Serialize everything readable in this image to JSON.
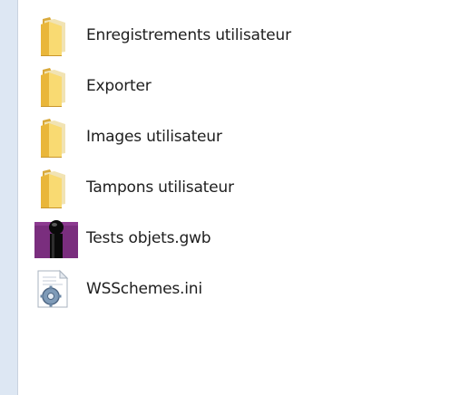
{
  "window": {
    "background_color": "#ffffff",
    "sidebar_color": "#dde7f3"
  },
  "file_list": {
    "items": [
      {
        "name": "Enregistrements utilisateur",
        "icon": "folder-icon"
      },
      {
        "name": "Exporter",
        "icon": "folder-icon"
      },
      {
        "name": "Images utilisateur",
        "icon": "folder-icon"
      },
      {
        "name": "Tampons utilisateur",
        "icon": "folder-icon"
      },
      {
        "name": "Tests objets.gwb",
        "icon": "gwb-file-icon"
      },
      {
        "name": "WSSchemes.ini",
        "icon": "ini-settings-file-icon"
      }
    ]
  }
}
